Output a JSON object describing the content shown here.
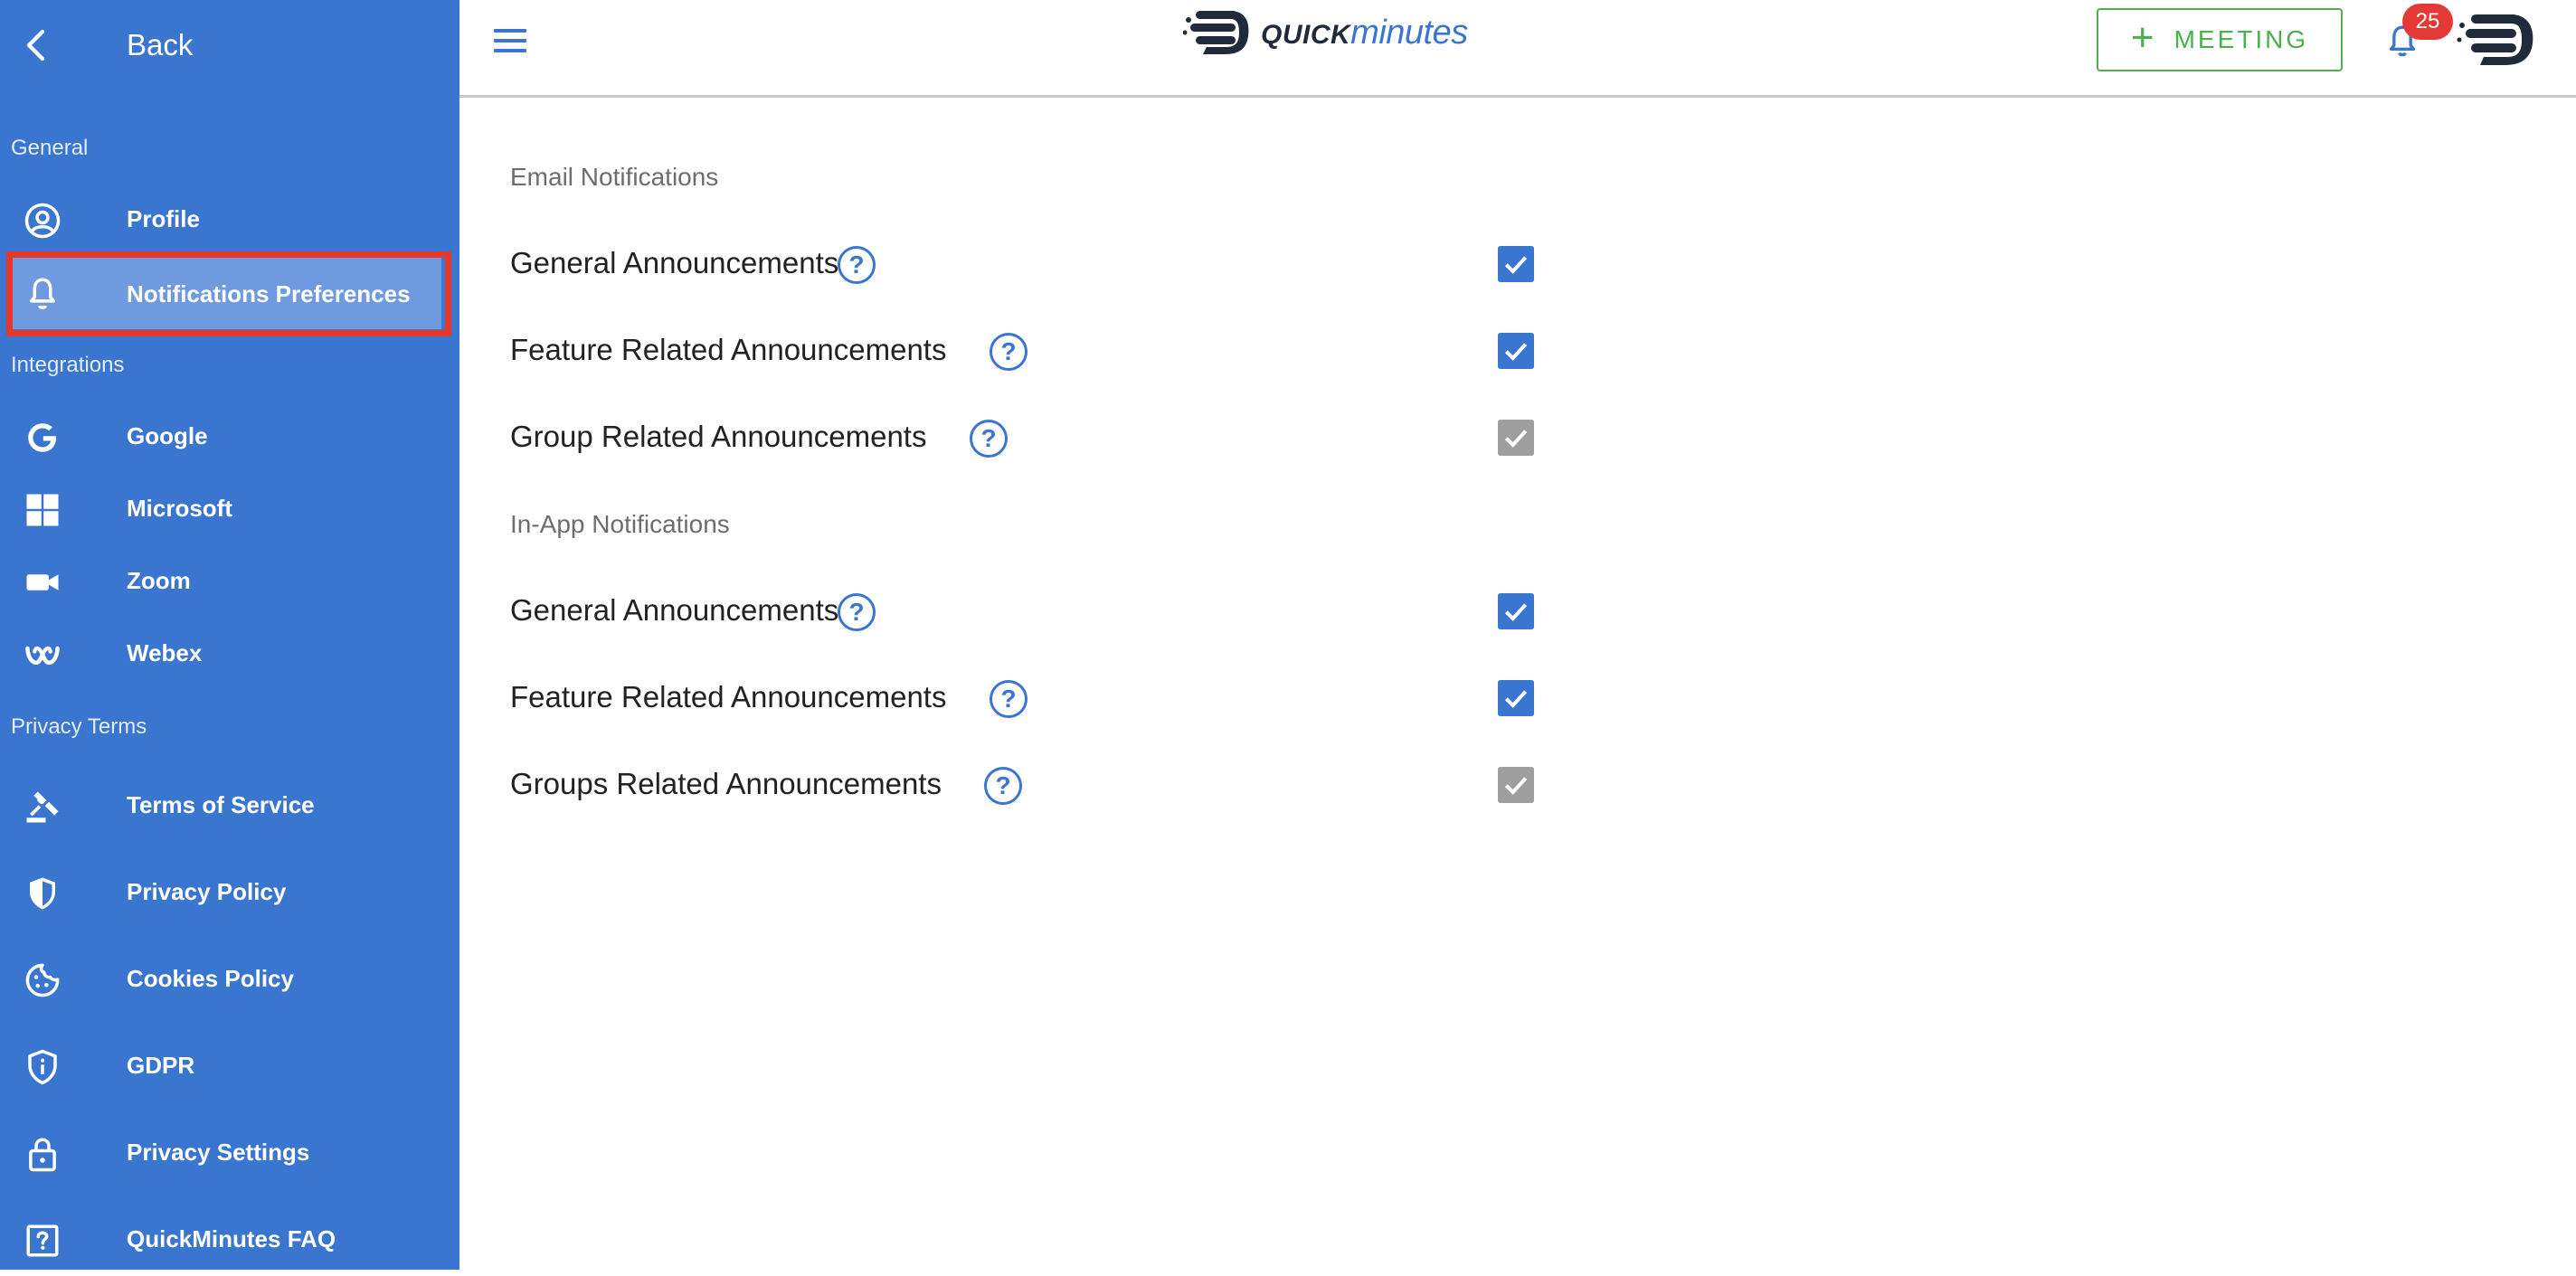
{
  "sidebar": {
    "back_label": "Back",
    "sections": {
      "general": "General",
      "integrations": "Integrations",
      "privacy": "Privacy Terms"
    },
    "items": {
      "profile": "Profile",
      "notifications": "Notifications Preferences",
      "google": "Google",
      "microsoft": "Microsoft",
      "zoom": "Zoom",
      "webex": "Webex",
      "terms": "Terms of Service",
      "privacy_policy": "Privacy Policy",
      "cookies": "Cookies Policy",
      "gdpr": "GDPR",
      "privacy_settings": "Privacy Settings",
      "faq": "QuickMinutes FAQ"
    },
    "active_item": "notifications"
  },
  "header": {
    "logo_part1": "QUICK",
    "logo_part2": "minutes",
    "meeting_label": "MEETING",
    "notification_count": "25"
  },
  "main": {
    "email_group_label": "Email Notifications",
    "inapp_group_label": "In-App Notifications",
    "email": [
      {
        "label": "General Announcements",
        "checked": true,
        "disabled": false
      },
      {
        "label": "Feature Related Announcements",
        "checked": true,
        "disabled": false
      },
      {
        "label": "Group Related Announcements",
        "checked": true,
        "disabled": true
      }
    ],
    "inapp": [
      {
        "label": "General Announcements",
        "checked": true,
        "disabled": false
      },
      {
        "label": "Feature Related Announcements",
        "checked": true,
        "disabled": false
      },
      {
        "label": "Groups Related Announcements",
        "checked": true,
        "disabled": true
      }
    ],
    "help_glyph": "?"
  },
  "colors": {
    "sidebar": "#3a76d0",
    "active_highlight": "#6f9ae0",
    "active_frame": "#e5372a",
    "checkbox_on": "#3a76d0",
    "checkbox_disabled": "#9e9e9e",
    "meeting_green": "#4caf50",
    "badge": "#e53935"
  },
  "icons": {
    "back": "chevron-left-icon",
    "profile": "user-circle-icon",
    "notifications": "bell-icon",
    "google": "google-icon",
    "microsoft": "windows-icon",
    "zoom": "video-camera-icon",
    "webex": "webex-icon",
    "terms": "gavel-icon",
    "privacy_policy": "shield-icon",
    "cookies": "cookie-icon",
    "gdpr": "shield-info-icon",
    "privacy_settings": "lock-icon",
    "faq": "question-box-icon"
  }
}
